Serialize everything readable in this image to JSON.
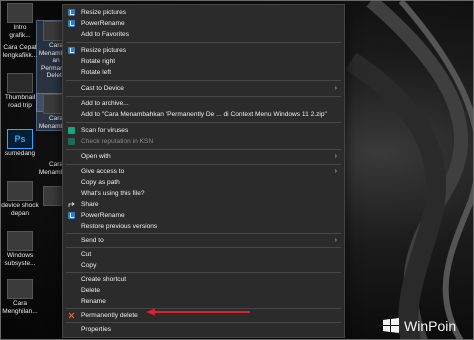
{
  "desktop_icons": [
    {
      "id": "i1",
      "label": "Intro\ngrafik..."
    },
    {
      "id": "i2",
      "label": "Cara Cepat\nlengkafikk..."
    },
    {
      "id": "i3",
      "label": "Cara\nMenamba...\nan\nPermanen\nDelete"
    },
    {
      "id": "i4",
      "label": "Thumbnail\nroad trip"
    },
    {
      "id": "i5",
      "label": "Cara\nMenamba..."
    },
    {
      "id": "i6",
      "label": "sumedang"
    },
    {
      "id": "i7",
      "label": "Cara\nMenamba..."
    },
    {
      "id": "i8",
      "label": "device shock\ndepan"
    },
    {
      "id": "i9",
      "label": "Windows\nsubsyste..."
    },
    {
      "id": "i10",
      "label": "Cara\nMenghilan..."
    }
  ],
  "menu": {
    "items": [
      {
        "label": "Resize pictures",
        "icon": "powertoys-icon"
      },
      {
        "label": "PowerRename",
        "icon": "powertoys-icon"
      },
      {
        "label": "Add to Favorites",
        "icon": ""
      },
      {
        "label": "Resize pictures",
        "icon": "powertoys-icon"
      },
      {
        "label": "Rotate right",
        "icon": ""
      },
      {
        "label": "Rotate left",
        "icon": ""
      },
      {
        "label": "Cast to Device",
        "icon": "",
        "submenu": true
      },
      {
        "label": "Add to archive...",
        "icon": ""
      },
      {
        "label": "Add to \"Cara Menambahkan 'Permanently De ... di Context Menu Windows 11 2.zip\"",
        "icon": ""
      },
      {
        "label": "Scan for viruses",
        "icon": "kaspersky-icon"
      },
      {
        "label": "Check reputation in KSN",
        "icon": "kaspersky-icon",
        "disabled": true
      },
      {
        "label": "Open with",
        "icon": "",
        "submenu": true
      },
      {
        "label": "Give access to",
        "icon": "",
        "submenu": true
      },
      {
        "label": "Copy as path",
        "icon": ""
      },
      {
        "label": "What's using this file?",
        "icon": ""
      },
      {
        "label": "Share",
        "icon": "share-icon"
      },
      {
        "label": "PowerRename",
        "icon": "powertoys-icon"
      },
      {
        "label": "Restore previous versions",
        "icon": ""
      },
      {
        "label": "Send to",
        "icon": "",
        "submenu": true
      },
      {
        "label": "Cut",
        "icon": ""
      },
      {
        "label": "Copy",
        "icon": ""
      },
      {
        "label": "Create shortcut",
        "icon": ""
      },
      {
        "label": "Delete",
        "icon": ""
      },
      {
        "label": "Rename",
        "icon": ""
      },
      {
        "label": "Permanently delete",
        "icon": "x-icon"
      },
      {
        "label": "Properties",
        "icon": ""
      }
    ],
    "submenu_arrow": "›"
  },
  "watermark": {
    "text": "WinPoin"
  },
  "colors": {
    "menu_bg": "#2b2b2b",
    "annotation_arrow": "#e0202a",
    "powertoys": "#2a7fd4",
    "kaspersky": "#1aa383"
  }
}
